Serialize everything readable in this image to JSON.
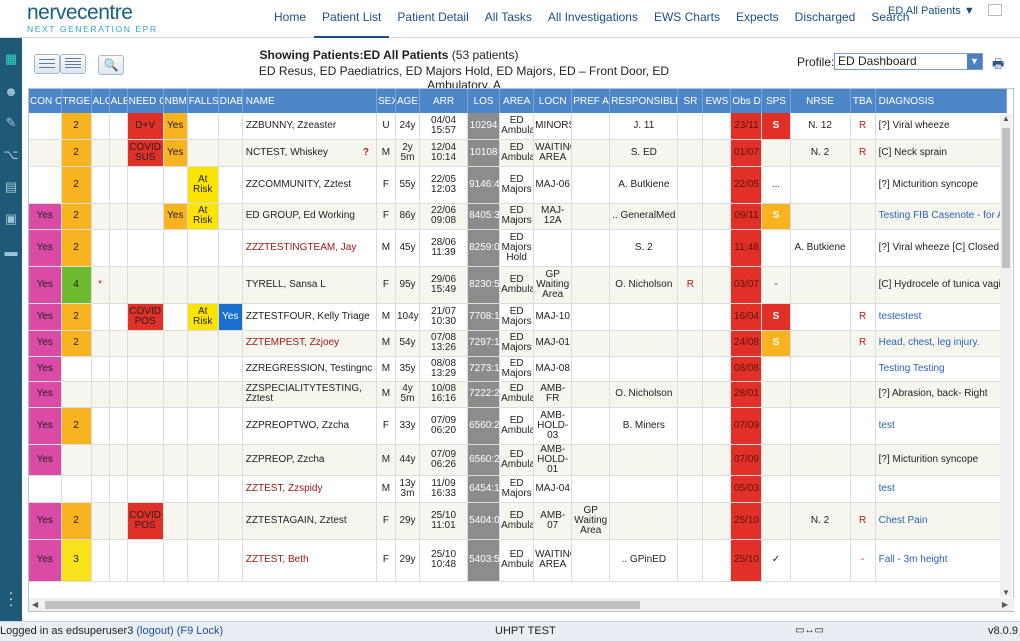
{
  "brand": {
    "name": "nervecentre",
    "tagline": "NEXT GENERATION EPR"
  },
  "nav": [
    "Home",
    "Patient List",
    "Patient Detail",
    "All Tasks",
    "All Investigations",
    "EWS Charts",
    "Expects",
    "Discharged",
    "Search"
  ],
  "active_tab": "Patient List",
  "ward_selector": "ED All Patients ▼",
  "toolbar": {
    "showing_label": "Showing Patients:",
    "showing_value": "ED All Patients",
    "count": "(53 patients)",
    "areas": "ED Resus, ED Paediatrics, ED Majors Hold, ED Majors, ED – Front Door, ED Ambulatory, A",
    "profile_label": "Profile:",
    "profile_value": "ED Dashboard"
  },
  "columns": [
    "CON CERN",
    "TRGE",
    "ALG",
    "ALE",
    "NEED CUBICL",
    "NBM",
    "FALLS RISK",
    "DIAB",
    "NAME",
    "SEX",
    "AGE",
    "ARR",
    "LOS",
    "AREA",
    "LOCN",
    "PREF AREA",
    "RESPONSIBLE CLINICIAN",
    "SR",
    "EWS",
    "Obs Due",
    "SPS",
    "NRSE",
    "TBA",
    "DIAGNOSIS"
  ],
  "rows": [
    {
      "concern": "",
      "trge": "2",
      "alg": "",
      "ale": "",
      "cubicle": "D+V",
      "nbm": "Yes",
      "falls": "",
      "diab": "",
      "name": "ZZBUNNY, Zzeaster",
      "name_red": false,
      "q": false,
      "sex": "U",
      "age": "24y",
      "arr": "04/04 15:57",
      "los": "10294",
      "area": "ED Ambulat",
      "locn": "MINORS",
      "pref": "",
      "clinician": "J. 11",
      "sr": "",
      "ews": "",
      "obs": "23/11",
      "sps": "S",
      "sps_c": "red",
      "nrse": "N. 12",
      "tba": "R",
      "diag": "[?] Viral wheeze",
      "diag_blue": false
    },
    {
      "concern": "",
      "trge": "2",
      "alg": "",
      "ale": "",
      "cubicle": "COVID SUS",
      "nbm": "Yes",
      "falls": "",
      "diab": "",
      "name": "NCTEST, Whiskey",
      "name_red": false,
      "q": true,
      "sex": "M",
      "age": "2y 5m",
      "arr": "12/04 10:14",
      "los": "10108",
      "area": "ED Ambulat",
      "locn": "WAITING AREA",
      "pref": "",
      "clinician": "S. ED",
      "sr": "",
      "ews": "",
      "obs": "01/07",
      "sps": "",
      "sps_c": "",
      "nrse": "N. 2",
      "tba": "R",
      "diag": "[C] Neck sprain",
      "diag_blue": false
    },
    {
      "concern": "",
      "trge": "2",
      "alg": "",
      "ale": "",
      "cubicle": "",
      "nbm": "",
      "falls": "At Risk",
      "diab": "",
      "name": "ZZCOMMUNITY, Zztest",
      "name_red": false,
      "q": false,
      "sex": "F",
      "age": "55y",
      "arr": "22/05 12:03",
      "los": "9146:4",
      "area": "ED Majors",
      "locn": "MAJ-06",
      "pref": "",
      "clinician": "A. Butkiene",
      "sr": "",
      "ews": "",
      "obs": "22/05",
      "sps": "...",
      "sps_c": "",
      "nrse": "",
      "tba": "",
      "diag": "[?] Micturition syncope",
      "diag_blue": false
    },
    {
      "concern": "Yes",
      "trge": "2",
      "alg": "",
      "ale": "",
      "cubicle": "",
      "nbm": "Yes",
      "falls": "At Risk",
      "diab": "",
      "name": "ED GROUP, Ed Working",
      "name_red": false,
      "q": false,
      "sex": "F",
      "age": "86y",
      "arr": "22/06 09:08",
      "los": "8405:3",
      "area": "ED Majors",
      "locn": "MAJ-12A",
      "pref": "",
      "clinician": ".. GeneralMed",
      "sr": "",
      "ews": "",
      "obs": "09/11",
      "sps": "S",
      "sps_c": "orn",
      "nrse": "",
      "tba": "",
      "diag": "Testing FIB Casenote - for Au",
      "diag_blue": true
    },
    {
      "concern": "Yes",
      "trge": "2",
      "alg": "",
      "ale": "",
      "cubicle": "",
      "nbm": "",
      "falls": "",
      "diab": "",
      "name": "ZZZTESTINGTEAM, Jay",
      "name_red": true,
      "q": false,
      "sex": "M",
      "age": "45y",
      "arr": "28/06 11:39",
      "los": "8259:0",
      "area": "ED Majors Hold",
      "locn": "",
      "pref": "",
      "clinician": "S. 2",
      "sr": "",
      "ews": "",
      "obs": "11:48",
      "sps": "",
      "sps_c": "",
      "nrse": "A. Butkiene",
      "tba": "",
      "diag": "[?] Viral wheeze [C] Closed fr",
      "diag_blue": false
    },
    {
      "concern": "Yes",
      "trge": "4",
      "alg": "*",
      "ale": "",
      "cubicle": "",
      "nbm": "",
      "falls": "",
      "diab": "",
      "name": "TYRELL, Sansa L",
      "name_red": false,
      "q": false,
      "sex": "F",
      "age": "95y",
      "arr": "29/06 15:49",
      "los": "8230:5",
      "area": "ED Ambulat",
      "locn": "GP Waiting Area",
      "pref": "",
      "clinician": "O. Nicholson",
      "sr": "R",
      "ews": "",
      "obs": "03/07",
      "sps": "-",
      "sps_c": "",
      "nrse": "",
      "tba": "",
      "diag": "[C] Hydrocele of tunica vagin",
      "diag_blue": false
    },
    {
      "concern": "Yes",
      "trge": "2",
      "alg": "",
      "ale": "",
      "cubicle": "COVID POS",
      "nbm": "",
      "falls": "At Risk",
      "diab": "Yes",
      "name": "ZZTESTFOUR, Kelly Triage",
      "name_red": false,
      "q": false,
      "sex": "M",
      "age": "104y",
      "arr": "21/07 10:30",
      "los": "7708:1",
      "area": "ED Majors",
      "locn": "MAJ-10",
      "pref": "",
      "clinician": "",
      "sr": "",
      "ews": "",
      "obs": "16/04",
      "sps": "S",
      "sps_c": "red",
      "nrse": "",
      "tba": "R",
      "diag": "testestest",
      "diag_blue": true
    },
    {
      "concern": "Yes",
      "trge": "2",
      "alg": "",
      "ale": "",
      "cubicle": "",
      "nbm": "",
      "falls": "",
      "diab": "",
      "name": "ZZTEMPEST, Zzjoey",
      "name_red": true,
      "q": false,
      "sex": "M",
      "age": "54y",
      "arr": "07/08 13:26",
      "los": "7297:1",
      "area": "ED Majors",
      "locn": "MAJ-01",
      "pref": "",
      "clinician": "",
      "sr": "",
      "ews": "",
      "obs": "24/08",
      "sps": "S",
      "sps_c": "orn",
      "nrse": "",
      "tba": "R",
      "diag": "Head, chest, leg injury.",
      "diag_blue": true
    },
    {
      "concern": "Yes",
      "trge": "",
      "alg": "",
      "ale": "",
      "cubicle": "",
      "nbm": "",
      "falls": "",
      "diab": "",
      "name": "ZZREGRESSION, Testingnc",
      "name_red": false,
      "q": false,
      "sex": "M",
      "age": "35y",
      "arr": "08/08 13:29",
      "los": "7273:1",
      "area": "ED Majors",
      "locn": "MAJ-08",
      "pref": "",
      "clinician": "",
      "sr": "",
      "ews": "",
      "obs": "08/08",
      "sps": "",
      "sps_c": "",
      "nrse": "",
      "tba": "",
      "diag": "Testing Testing",
      "diag_blue": true
    },
    {
      "concern": "Yes",
      "trge": "",
      "alg": "",
      "ale": "",
      "cubicle": "",
      "nbm": "",
      "falls": "",
      "diab": "",
      "name": "ZZSPECIALITYTESTING, Zztest",
      "name_red": false,
      "q": false,
      "sex": "M",
      "age": "4y 5m",
      "arr": "10/08 16:16",
      "los": "7222:2",
      "area": "ED Ambulat",
      "locn": "AMB-FR",
      "pref": "",
      "clinician": "O. Nicholson",
      "sr": "",
      "ews": "",
      "obs": "28/01",
      "sps": "",
      "sps_c": "",
      "nrse": "",
      "tba": "",
      "diag": "[?] Abrasion, back- Right",
      "diag_blue": false
    },
    {
      "concern": "Yes",
      "trge": "2",
      "alg": "",
      "ale": "",
      "cubicle": "",
      "nbm": "",
      "falls": "",
      "diab": "",
      "name": "ZZPREOPTWO, Zzcha",
      "name_red": false,
      "q": false,
      "sex": "F",
      "age": "33y",
      "arr": "07/09 06:20",
      "los": "6560:2",
      "area": "ED Ambulat",
      "locn": "AMB-HOLD-03",
      "pref": "",
      "clinician": "B. Miners",
      "sr": "",
      "ews": "",
      "obs": "07/09",
      "sps": "",
      "sps_c": "",
      "nrse": "",
      "tba": "",
      "diag": "test",
      "diag_blue": true
    },
    {
      "concern": "Yes",
      "trge": "",
      "alg": "",
      "ale": "",
      "cubicle": "",
      "nbm": "",
      "falls": "",
      "diab": "",
      "name": "ZZPREOP, Zzcha",
      "name_red": false,
      "q": false,
      "sex": "M",
      "age": "44y",
      "arr": "07/09 06:26",
      "los": "6560:2",
      "area": "ED Ambulat",
      "locn": "AMB-HOLD-01",
      "pref": "",
      "clinician": "",
      "sr": "",
      "ews": "",
      "obs": "07/09",
      "sps": "",
      "sps_c": "",
      "nrse": "",
      "tba": "",
      "diag": "[?] Micturition syncope",
      "diag_blue": false
    },
    {
      "concern": "",
      "trge": "",
      "alg": "",
      "ale": "",
      "cubicle": "",
      "nbm": "",
      "falls": "",
      "diab": "",
      "name": "ZZTEST, Zzspidy",
      "name_red": true,
      "q": false,
      "sex": "M",
      "age": "13y 3m",
      "arr": "11/09 16:33",
      "los": "6454:1",
      "area": "ED Majors",
      "locn": "MAJ-04",
      "pref": "",
      "clinician": "",
      "sr": "",
      "ews": "",
      "obs": "05/03",
      "sps": "",
      "sps_c": "",
      "nrse": "",
      "tba": "",
      "diag": "test",
      "diag_blue": true
    },
    {
      "concern": "Yes",
      "trge": "2",
      "alg": "",
      "ale": "",
      "cubicle": "COVID POS",
      "nbm": "",
      "falls": "",
      "diab": "",
      "name": "ZZTESTAGAIN, Zztest",
      "name_red": false,
      "q": false,
      "sex": "F",
      "age": "29y",
      "arr": "25/10 11:01",
      "los": "5404:0",
      "area": "ED Ambulat",
      "locn": "AMB-07",
      "pref": "GP Waiting Area",
      "clinician": "",
      "sr": "",
      "ews": "",
      "obs": "25/10",
      "sps": "",
      "sps_c": "",
      "nrse": "N. 2",
      "tba": "R",
      "diag": "Chest Pain",
      "diag_blue": true
    },
    {
      "concern": "Yes",
      "trge": "3",
      "alg": "",
      "ale": "",
      "cubicle": "",
      "nbm": "",
      "falls": "",
      "diab": "",
      "name": "ZZTEST, Beth",
      "name_red": true,
      "q": false,
      "sex": "F",
      "age": "29y",
      "arr": "25/10 10:48",
      "los": "5403:5",
      "area": "ED Ambulat",
      "locn": "WAITING AREA",
      "pref": "",
      "clinician": ".. GPinED",
      "sr": "",
      "ews": "",
      "obs": "25/10",
      "sps": "✓",
      "sps_c": "",
      "nrse": "",
      "tba": "-",
      "diag": "Fall - 3m height",
      "diag_blue": true
    }
  ],
  "footer": {
    "logged_in": "Logged in as edsuperuser3",
    "logout": "(logout)",
    "f9": "(F9 Lock)",
    "site": "UHPT TEST",
    "version": "v8.0.9"
  }
}
